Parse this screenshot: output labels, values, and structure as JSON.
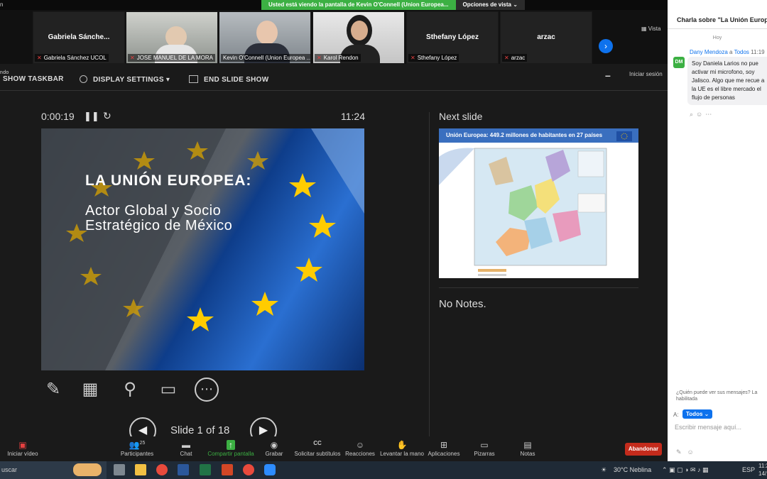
{
  "window": {
    "title_fragment": "n"
  },
  "share_banner": {
    "status": "Usted está viendo la pantalla de Kevin O'Connell (Union Europea...",
    "options": "Opciones de vista",
    "options_chevron": "⌄"
  },
  "thumbnails": [
    {
      "name_big": "Gabriela Sánche...",
      "label": "Gabriela Sánchez UCOL",
      "video": false
    },
    {
      "name_big": "",
      "label": "JOSE MANUEL DE LA MORA",
      "video": true,
      "bg": "#b9bcb8",
      "shirt": "#d9d9d9"
    },
    {
      "name_big": "",
      "label": "Kevin O'Connell (Union Europea ...",
      "video": true,
      "bg": "#9fa4a8",
      "shirt": "#2b2f3a"
    },
    {
      "name_big": "",
      "label": "Karol Rendon",
      "video": true,
      "bg": "#dcdcdc",
      "shirt": "#1c1c1c"
    },
    {
      "name_big": "Sthefany López",
      "label": "Sthefany López",
      "video": false
    },
    {
      "name_big": "arzac",
      "label": "arzac",
      "video": false
    }
  ],
  "thumbnails_next_icon": "chevron-right-icon",
  "view_label": "Vista",
  "slideshow_toolbar": {
    "left_fragment": "ndo",
    "show_taskbar": "SHOW TASKBAR",
    "display_settings": "DISPLAY SETTINGS ▾",
    "end_show": "END SLIDE SHOW",
    "minimize": "–",
    "iniciar_sesion": "Iniciar sesión"
  },
  "presenter": {
    "elapsed": "0:00:19",
    "pause_icon": "❚❚",
    "restart_icon": "↻",
    "clock": "11:24",
    "slide_title": "LA UNIÓN EUROPEA:",
    "slide_subtitle_1": "Actor Global y Socio",
    "slide_subtitle_2": "Estratégico de México",
    "slide_counter": "Slide 1 of 18",
    "prev_icon": "◀",
    "next_icon": "▶",
    "next_slide_label": "Next slide",
    "next_slide_heading": "Unión Europea: 449.2 millones de habitantes en 27 países",
    "notes": "No Notes."
  },
  "presenter_tools": [
    {
      "name": "pen-icon",
      "glyph": "✎"
    },
    {
      "name": "slide-sorter-icon",
      "glyph": "▦"
    },
    {
      "name": "zoom-icon",
      "glyph": "⚲"
    },
    {
      "name": "black-screen-icon",
      "glyph": "▭"
    },
    {
      "name": "more-options-icon",
      "glyph": "⋯"
    }
  ],
  "meeting_bar": {
    "video": "Iniciar vídeo",
    "participants": "Participantes",
    "participants_count": "25",
    "chat": "Chat",
    "share": "Compartir pantalla",
    "record": "Grabar",
    "subtitles": "Solicitar subtítulos",
    "reactions": "Reacciones",
    "raise_hand": "Levantar la mano",
    "apps": "Aplicaciones",
    "whiteboards": "Pizarras",
    "notes": "Notas",
    "leave": "Abandonar"
  },
  "chat": {
    "title": "Charla sobre \"La Unión Europea\"",
    "day": "Hoy",
    "avatar": "DM",
    "sender": "Dany Mendoza",
    "to_word": "a",
    "recipient": "Todos",
    "time": "11:19",
    "message": "Soy Daniela Larios no pue activar mi microfono, soy Jalisco. Algo que me recue a la UE es el libre mercado el flujo de personas",
    "who_can_see": "¿Quién puede ver sus mensajes? La habilitada",
    "to_label": "A:",
    "to_value": "Todos ⌄",
    "input_placeholder": "Escribir mensaje aquí..."
  },
  "taskbar": {
    "search": "uscar",
    "weather": "30°C  Neblina",
    "lang": "ESP",
    "time": "11:2",
    "date": "14/1"
  },
  "colors": {
    "zoom_blue": "#0e72ed",
    "share_green": "#3cb043",
    "leave_red": "#c42b1c",
    "eu_blue": "#1f4fa3",
    "eu_star": "#ffcc00"
  }
}
